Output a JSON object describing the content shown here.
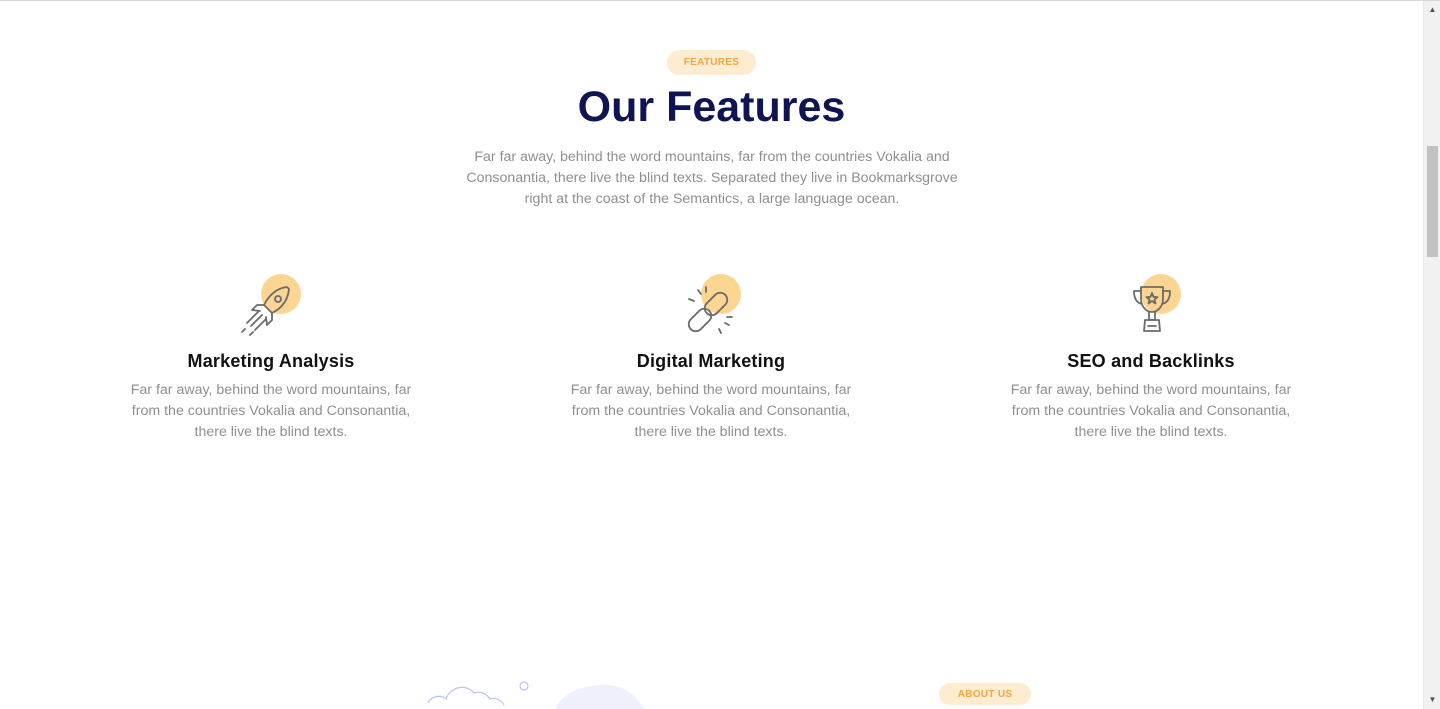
{
  "section": {
    "badge": "FEATURES",
    "title": "Our Features",
    "description": "Far far away, behind the word mountains, far from the countries Vokalia and Consonantia, there live the blind texts. Separated they live in Bookmarksgrove right at the coast of the Semantics, a large language ocean."
  },
  "features": [
    {
      "icon": "rocket-icon",
      "title": "Marketing Analysis",
      "text": "Far far away, behind the word mountains, far from the countries Vokalia and Consonantia, there live the blind texts."
    },
    {
      "icon": "chain-link-icon",
      "title": "Digital Marketing",
      "text": "Far far away, behind the word mountains, far from the countries Vokalia and Consonantia, there live the blind texts."
    },
    {
      "icon": "trophy-icon",
      "title": "SEO and Backlinks",
      "text": "Far far away, behind the word mountains, far from the countries Vokalia and Consonantia, there live the blind texts."
    }
  ],
  "next_section": {
    "badge": "ABOUT US"
  },
  "colors": {
    "title": "#0f1452",
    "accent": "#f3a73a",
    "accent_light": "#fdeccf",
    "icon_circle": "#fdd593",
    "body_text": "#8f8f8f"
  }
}
